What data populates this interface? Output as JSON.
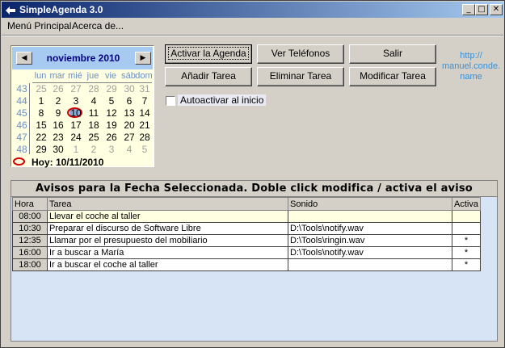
{
  "window": {
    "title": "SimpleAgenda 3.0",
    "minimize": "_",
    "maximize": "□",
    "close": "✕"
  },
  "menu": [
    "Menú Principal",
    "Acerca de..."
  ],
  "calendar": {
    "month_label": "noviembre 2010",
    "prev": "◀",
    "next": "▶",
    "weekdays": [
      "lun",
      "mar",
      "mié",
      "jue",
      "vie",
      "sáb",
      "dom"
    ],
    "weeks": [
      "43",
      "44",
      "45",
      "46",
      "47",
      "48"
    ],
    "rows": [
      [
        "25",
        "26",
        "27",
        "28",
        "29",
        "30",
        "31"
      ],
      [
        "1",
        "2",
        "3",
        "4",
        "5",
        "6",
        "7"
      ],
      [
        "8",
        "9",
        "10",
        "11",
        "12",
        "13",
        "14"
      ],
      [
        "15",
        "16",
        "17",
        "18",
        "19",
        "20",
        "21"
      ],
      [
        "22",
        "23",
        "24",
        "25",
        "26",
        "27",
        "28"
      ],
      [
        "29",
        "30",
        "1",
        "2",
        "3",
        "4",
        "5"
      ]
    ],
    "selected_day": "10",
    "today_label": "Hoy: 10/11/2010"
  },
  "buttons": {
    "activar": "Activar la Agenda",
    "ver_telefonos": "Ver Teléfonos",
    "salir": "Salir",
    "anadir": "Añadir Tarea",
    "eliminar": "Eliminar Tarea",
    "modificar": "Modificar Tarea"
  },
  "link_text": "http://\nmanuel.conde.\nname",
  "autoactivar_label": "Autoactivar al inicio",
  "autoactivar_checked": false,
  "avisos": {
    "title": "Avisos para la Fecha Seleccionada. Doble click modifica / activa el aviso",
    "columns": [
      "Hora",
      "Tarea",
      "Sonido",
      "Activa"
    ],
    "rows": [
      {
        "hora": "08:00",
        "tarea": "Llevar el coche al taller",
        "sonido": "",
        "activa": ""
      },
      {
        "hora": "10:30",
        "tarea": "Preparar el discurso de Software Libre",
        "sonido": "D:\\Tools\\notify.wav",
        "activa": ""
      },
      {
        "hora": "12:35",
        "tarea": "Llamar por el presupuesto del mobiliario",
        "sonido": "D:\\Tools\\ringin.wav",
        "activa": "*"
      },
      {
        "hora": "16:00",
        "tarea": "Ir a buscar a María",
        "sonido": "D:\\Tools\\notify.wav",
        "activa": "*"
      },
      {
        "hora": "18:00",
        "tarea": "Ir a buscar el coche al taller",
        "sonido": "",
        "activa": "*"
      }
    ]
  },
  "colors": {
    "title_start": "#0a246a",
    "title_end": "#a6caf0",
    "calendar_bg": "#ffffe1",
    "panel_bg": "#d6e4f5",
    "link": "#3a8fd8",
    "highlight": "#d00000"
  }
}
